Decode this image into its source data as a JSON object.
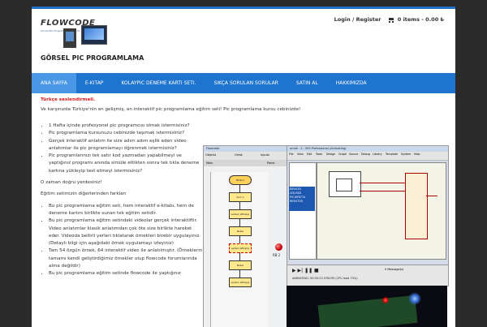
{
  "brand": {
    "logo_text": "FLOWCODE",
    "logo_tagline": "Görsel PIC Programlama Sistemi",
    "site_title": "GÖRSEL PIC PROGRAMLAMA"
  },
  "top_links": {
    "account": "Login / Register",
    "cart": "0 items - 0.00 ₺"
  },
  "nav": [
    {
      "label": "ANA SAYFA",
      "active": true
    },
    {
      "label": "E-KITAP"
    },
    {
      "label": "KOLAYPIC DENEME KARTI SETI."
    },
    {
      "label": "SIKÇA SORULAN SORULAR"
    },
    {
      "label": "SATIN AL"
    },
    {
      "label": "HAKKIMIZDA"
    }
  ],
  "content": {
    "highlight": "Türkçe seslendirmeli.",
    "intro": "Ve karşınızda Türkiye'nin en gelişmiş, en interaktif pic programlama eğitim seti! Pic programlama kursu cebinizde!",
    "bullets1": [
      "1 Hafta içinde profesyonel pic programcısı olmak istermisiniz?",
      "Pic programlama kursunuzu cebinizde taşımak istermisiniz?",
      "Gerçek interaktif anlatım ile size adım adım eşlik eden video anlatımlar ile pic programlamayı öğrenmek istermisiniz?",
      "Pic programlarınızı tek satır kod yazmadan yapabilmeyi ve yaptığınız programı anında simüle ettikten sonra tek tıkla deneme kartına yükleyip test etmeyi istermisiniz?"
    ],
    "para1": "O zaman doğru yerdesiniz!",
    "para2": "Eğitim setimizin diğerlerinden farkları",
    "bullets2": [
      "Bu pic programlama eğitim seti, hem interaktif e-kitabı, hem de deneme kartını birlikte sunan tek eğitim setidir.",
      "Bu pic programlama eğitim setindeki videolar gerçek interaktiftir. Video anlatımlar klasik anlatımdan çok öte size birlikte hareket eder. Videoda bellirli yerleri tıklatarak örnekleri birebir uygulayınız.(Detaylı bilgi için aşağıdaki örnek uygulamayı izleyiniz)",
      "Tam 54 özgün örnek, 64 interaktif video ile anlatılmıştır. (Örneklerin tamamı kendi geliştirdiğimiz örnekler olup flowcode forumlarında alma değildir)",
      "Bu pic programlama eğitim setinde flowcode ile yaptığınız"
    ]
  },
  "screenshot_flowcode": {
    "title": "Flowcode",
    "menu": [
      "Objects",
      "Ortak",
      "Inputs"
    ],
    "tab": "Main",
    "panel": "Panel",
    "nodes": [
      "BAŞLA",
      "İkon 1",
      "Ledleri LEDs(a)",
      "Ledleri LEDs(a)",
      "Bekle",
      "Ledleri LEDs(a)",
      "Bekle"
    ],
    "led_label": "RB 2"
  },
  "screenshot_proteus": {
    "title": "ornek - 2 - ISIS Professional (Animating)",
    "menu": [
      "File",
      "View",
      "Edit",
      "Tools",
      "Design",
      "Graph",
      "Source",
      "Debug",
      "Library",
      "Template",
      "System",
      "Help"
    ],
    "devices_header": "DEVICES",
    "devices": [
      "LED-RED",
      "PIC16F877A",
      "RESISTOR"
    ],
    "status": "ANIMATING: 00:00:23.378295 (CPU load 75%)",
    "messages": "0 Message(s)"
  }
}
